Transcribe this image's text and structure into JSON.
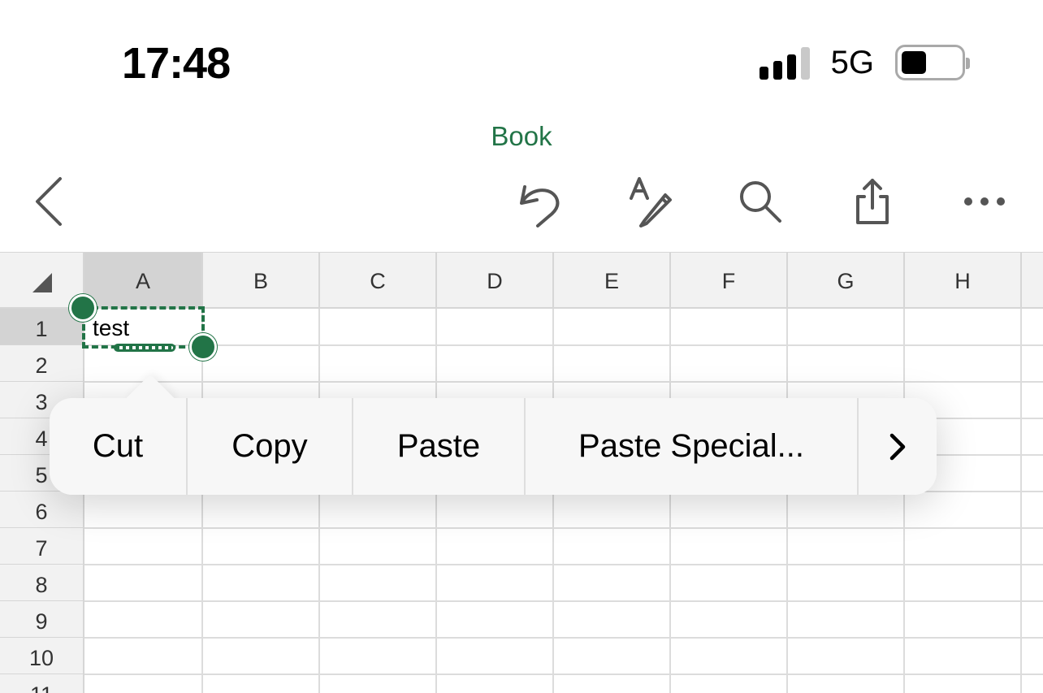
{
  "status_bar": {
    "time": "17:48",
    "network": "5G",
    "signal_bars_active": 3,
    "signal_bars_total": 4,
    "battery_level": 0.4
  },
  "document": {
    "title": "Book"
  },
  "toolbar": {
    "back_icon": "chevron-left-icon",
    "undo_icon": "undo-icon",
    "draw_icon": "draw-pen-icon",
    "search_icon": "search-icon",
    "share_icon": "share-icon",
    "more_icon": "more-icon"
  },
  "grid": {
    "columns": [
      "A",
      "B",
      "C",
      "D",
      "E",
      "F",
      "G",
      "H"
    ],
    "rows": [
      "1",
      "2",
      "3",
      "4",
      "5",
      "6",
      "7",
      "8",
      "9",
      "10",
      "11"
    ],
    "selected_column": "A",
    "selected_row": "1",
    "cells": {
      "A1": "test"
    }
  },
  "context_menu": {
    "items": [
      "Cut",
      "Copy",
      "Paste",
      "Paste Special..."
    ],
    "more_icon": "chevron-right-icon"
  },
  "colors": {
    "accent": "#227447",
    "header_bg": "#f2f2f2",
    "header_selected": "#d3d3d3",
    "gridline": "#dcdcdc",
    "menu_bg": "#f7f7f7"
  }
}
